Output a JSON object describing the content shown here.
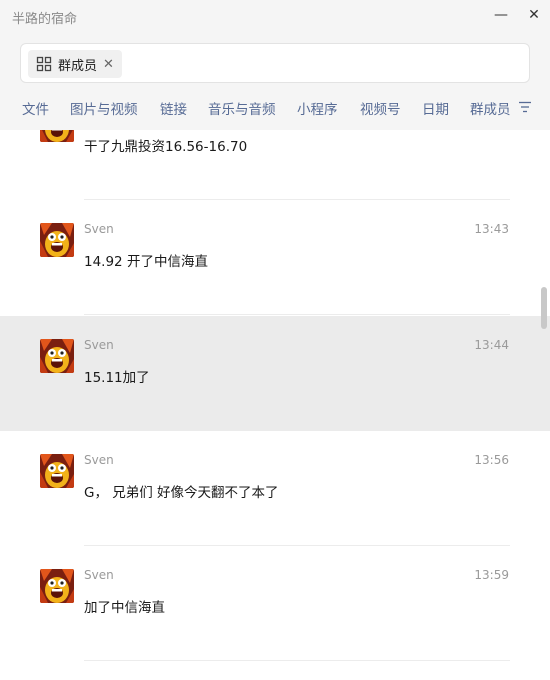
{
  "window": {
    "title": "半路的宿命",
    "minimize_glyph": "—",
    "close_glyph": "✕"
  },
  "search": {
    "chip_label": "群成员",
    "chip_icon": "grid-icon",
    "chip_close_glyph": "✕"
  },
  "tabs": [
    {
      "label": "文件"
    },
    {
      "label": "图片与视频"
    },
    {
      "label": "链接"
    },
    {
      "label": "音乐与音频"
    },
    {
      "label": "小程序"
    },
    {
      "label": "视频号"
    },
    {
      "label": "日期"
    },
    {
      "label": "群成员"
    }
  ],
  "filter_icon": "filter-icon",
  "messages": [
    {
      "sender": "",
      "time": "",
      "text": "干了九鼎投资16.56-16.70",
      "highlighted": false
    },
    {
      "sender": "Sven",
      "time": "13:43",
      "text": "14.92 开了中信海直",
      "highlighted": false
    },
    {
      "sender": "Sven",
      "time": "13:44",
      "text": "15.11加了",
      "highlighted": true
    },
    {
      "sender": "Sven",
      "time": "13:56",
      "text": "G， 兄弟们 好像今天翻不了本了",
      "highlighted": false
    },
    {
      "sender": "Sven",
      "time": "13:59",
      "text": "加了中信海直",
      "highlighted": false
    }
  ],
  "colors": {
    "accent_link": "#576b95",
    "highlight_row": "#ebebeb",
    "meta_text": "#9a9a9a"
  }
}
